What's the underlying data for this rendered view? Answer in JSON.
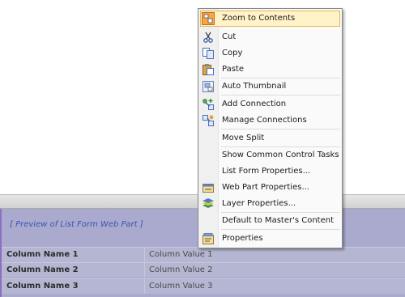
{
  "webpart": {
    "title": "[ Preview of List Form Web Part ]",
    "rows": [
      {
        "name": "Column Name 1",
        "value": "Column Value 1"
      },
      {
        "name": "Column Name 2",
        "value": "Column Value 2"
      },
      {
        "name": "Column Name 3",
        "value": "Column Value 3"
      }
    ]
  },
  "context_menu": {
    "items": [
      {
        "label": "Zoom to Contents",
        "icon": "zoom-to-contents-icon",
        "highlighted": true
      },
      {
        "label": "Cut",
        "icon": "scissors-icon"
      },
      {
        "label": "Copy",
        "icon": "copy-icon"
      },
      {
        "label": "Paste",
        "icon": "paste-icon"
      },
      {
        "label": "Auto Thumbnail",
        "icon": "auto-thumbnail-icon"
      },
      {
        "label": "Add Connection",
        "icon": "add-connection-icon"
      },
      {
        "label": "Manage Connections",
        "icon": "manage-connections-icon"
      },
      {
        "label": "Move Split",
        "icon": ""
      },
      {
        "label": "Show Common Control Tasks",
        "icon": ""
      },
      {
        "label": "List Form Properties...",
        "icon": ""
      },
      {
        "label": "Web Part Properties...",
        "icon": "web-part-properties-icon"
      },
      {
        "label": "Layer Properties...",
        "icon": "layer-properties-icon"
      },
      {
        "label": "Default to Master's Content",
        "icon": ""
      },
      {
        "label": "Properties",
        "icon": "properties-icon"
      }
    ]
  },
  "colors": {
    "menu_highlight": "#fff3c7",
    "menu_highlight_border": "#e3b855",
    "webpart_bg": "#a9aace",
    "webpart_title": "#3a55b0"
  }
}
